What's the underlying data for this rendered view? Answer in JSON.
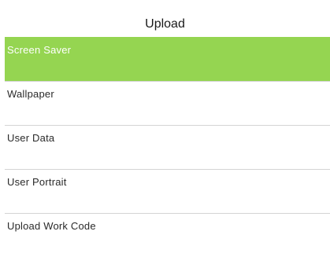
{
  "screen": {
    "title": "Upload",
    "selected_color": "#95d551"
  },
  "menu": {
    "items": [
      {
        "label": "Screen Saver",
        "selected": true
      },
      {
        "label": "Wallpaper",
        "selected": false
      },
      {
        "label": "User Data",
        "selected": false
      },
      {
        "label": "User Portrait",
        "selected": false
      },
      {
        "label": "Upload Work Code",
        "selected": false
      }
    ]
  }
}
